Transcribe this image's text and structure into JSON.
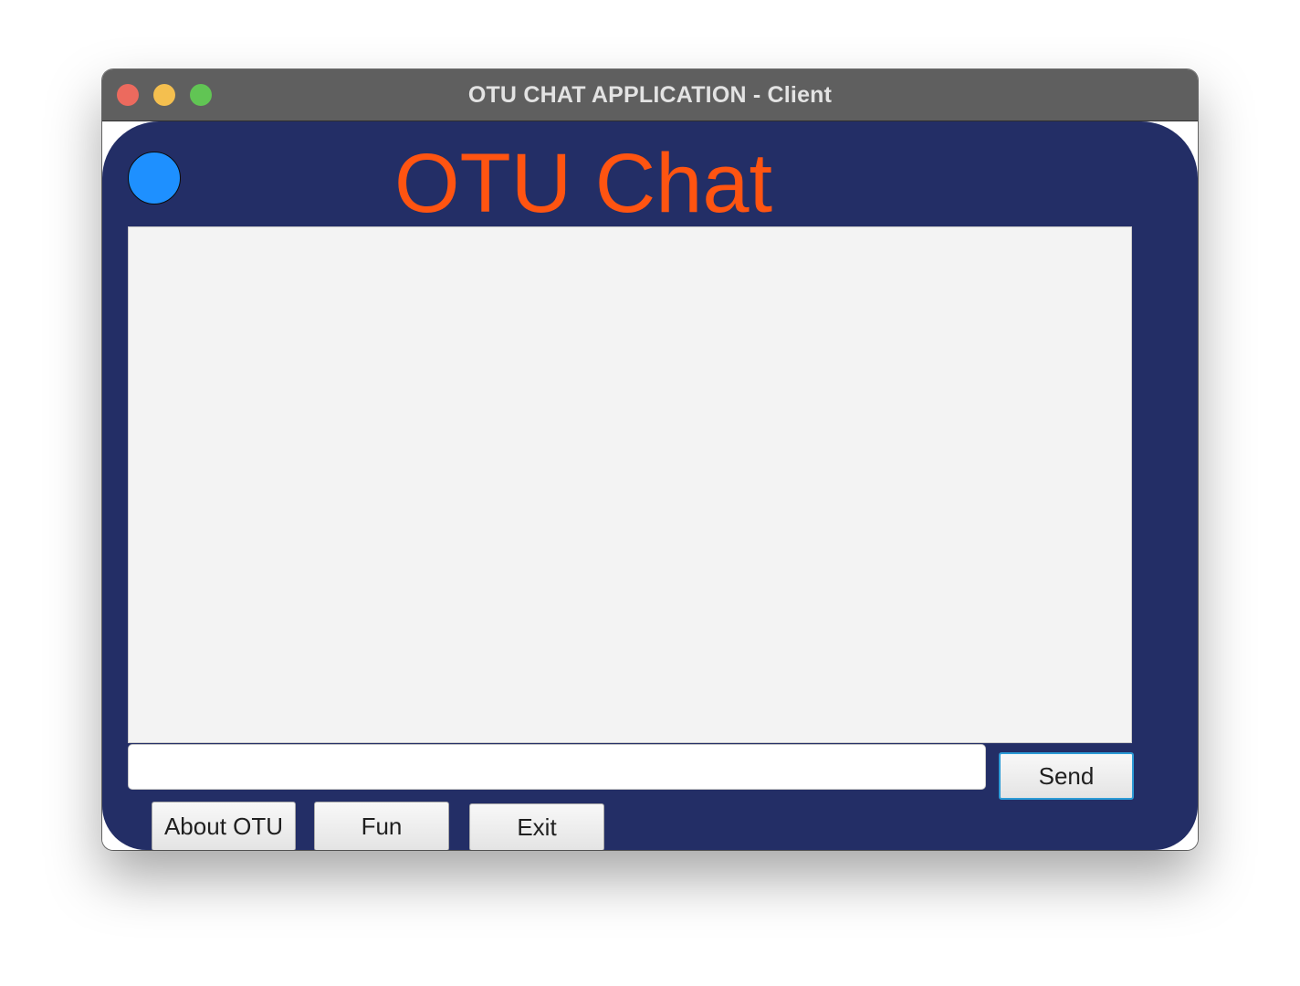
{
  "window": {
    "title": "OTU CHAT APPLICATION - Client"
  },
  "header": {
    "heading": "OTU Chat",
    "heading_color": "#ff5411",
    "status_dot_color": "#1e90ff"
  },
  "chat": {
    "messages": [],
    "input_value": "",
    "send_label": "Send"
  },
  "footer": {
    "about_label": "About OTU",
    "fun_label": "Fun",
    "exit_label": "Exit"
  },
  "colors": {
    "panel_background": "#232e66",
    "titlebar": "#5f5f5f"
  }
}
